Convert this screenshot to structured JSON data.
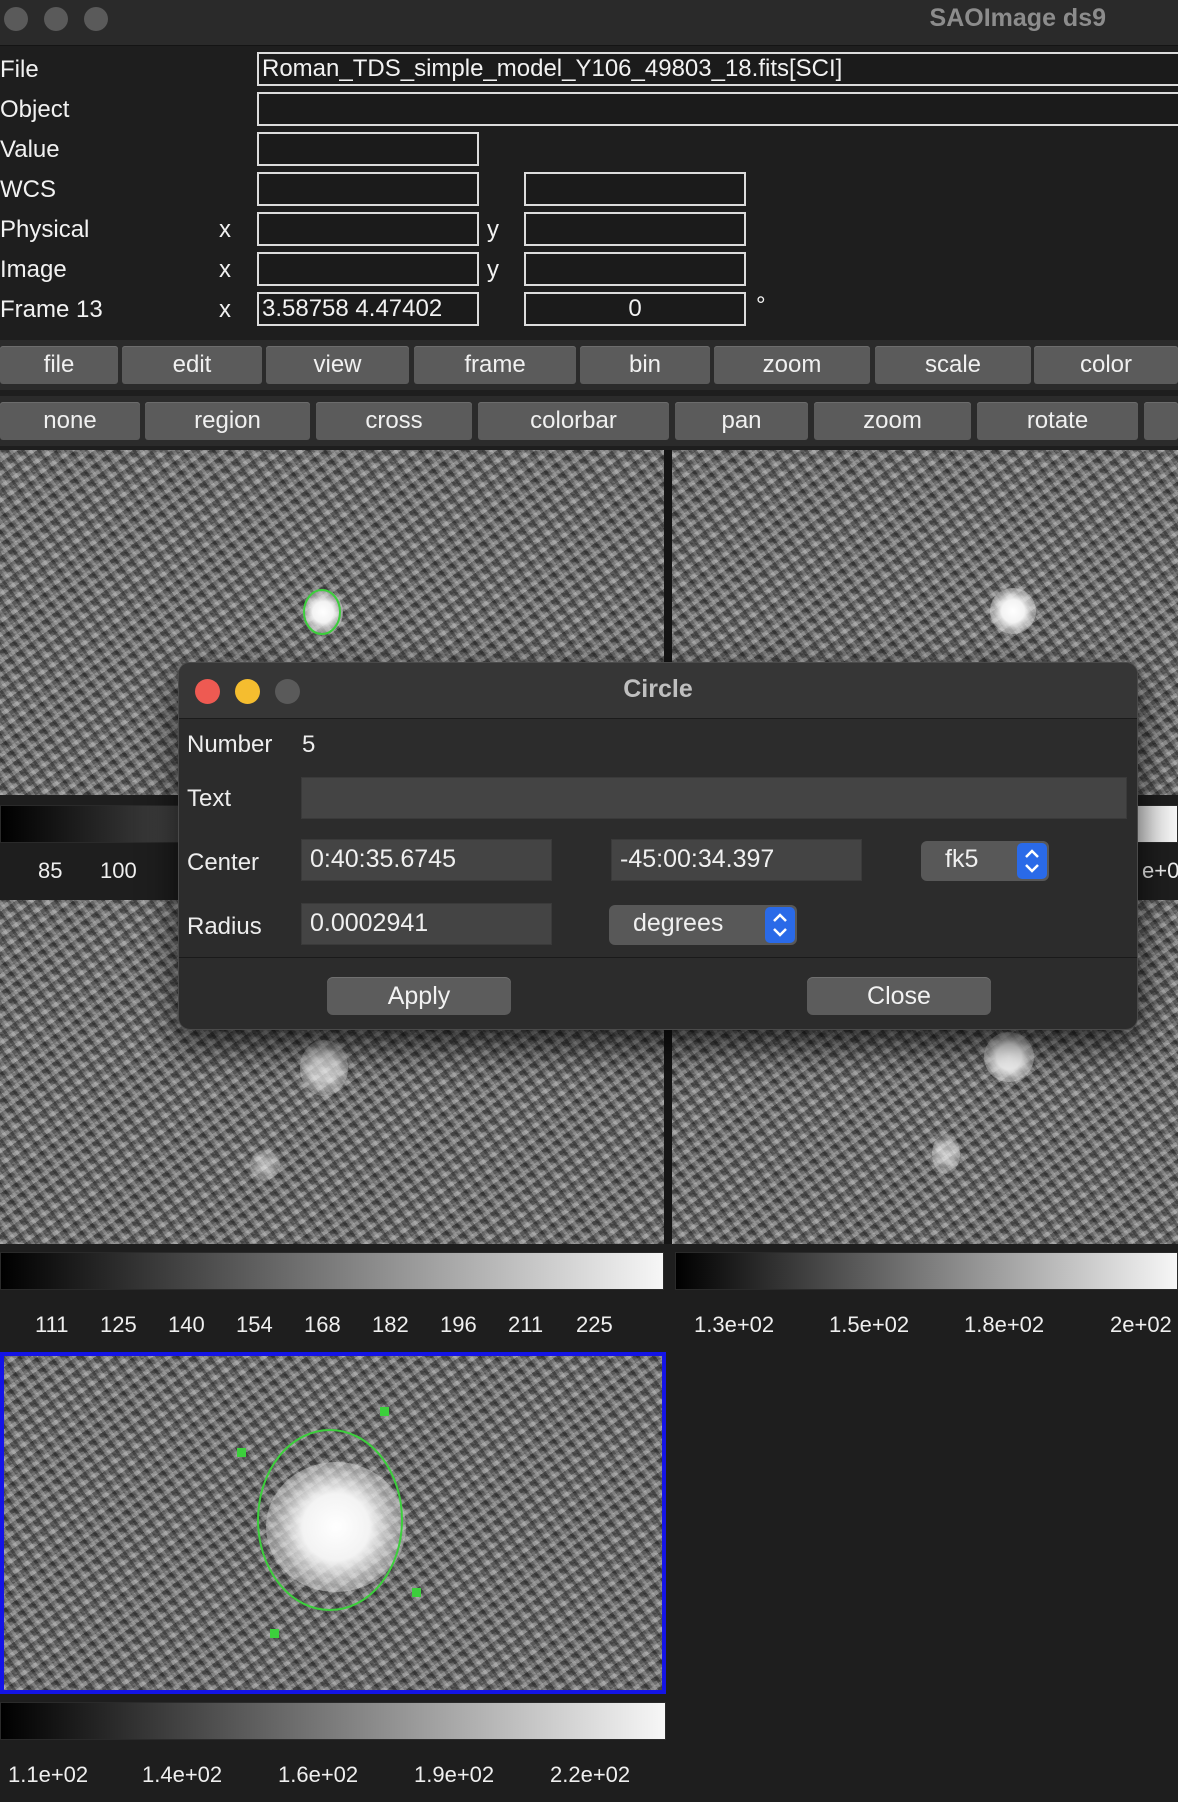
{
  "window": {
    "title": "SAOImage ds9"
  },
  "info": {
    "file_label": "File",
    "file_value": "Roman_TDS_simple_model_Y106_49803_18.fits[SCI]",
    "object_label": "Object",
    "object_value": "",
    "value_label": "Value",
    "value_value": "",
    "wcs_label": "WCS",
    "physical_label": "Physical",
    "image_label": "Image",
    "frame_label": "Frame 13",
    "x_label": "x",
    "y_label": "y",
    "frame_zoom": "3.58758 4.47402",
    "frame_angle": "0",
    "degree_symbol": "°"
  },
  "menubar": [
    "file",
    "edit",
    "view",
    "frame",
    "bin",
    "zoom",
    "scale",
    "color"
  ],
  "buttonbar": [
    "none",
    "region",
    "cross",
    "colorbar",
    "pan",
    "zoom",
    "rotate"
  ],
  "colorbars": {
    "top_left_ticks": [
      "85",
      "100"
    ],
    "top_right_ticks": [
      "e+0"
    ],
    "mid_left_ticks": [
      "111",
      "125",
      "140",
      "154",
      "168",
      "182",
      "196",
      "211",
      "225"
    ],
    "mid_right_ticks": [
      "1.3e+02",
      "1.5e+02",
      "1.8e+02",
      "2e+02"
    ],
    "bottom_ticks": [
      "1.1e+02",
      "1.4e+02",
      "1.6e+02",
      "1.9e+02",
      "2.2e+02"
    ]
  },
  "dialog": {
    "title": "Circle",
    "number_label": "Number",
    "number_value": "5",
    "text_label": "Text",
    "text_value": "",
    "center_label": "Center",
    "center_ra": "0:40:35.6745",
    "center_dec": "-45:00:34.397",
    "coord_system": "fk5",
    "radius_label": "Radius",
    "radius_value": "0.0002941",
    "radius_units": "degrees",
    "apply_label": "Apply",
    "close_label": "Close"
  },
  "colors": {
    "region_green": "#3ccf3c",
    "current_frame_border": "#1414e6",
    "stepper_blue": "#2a6ae8",
    "close_red": "#ee5a52",
    "minimize_yellow": "#f5bd2f"
  }
}
